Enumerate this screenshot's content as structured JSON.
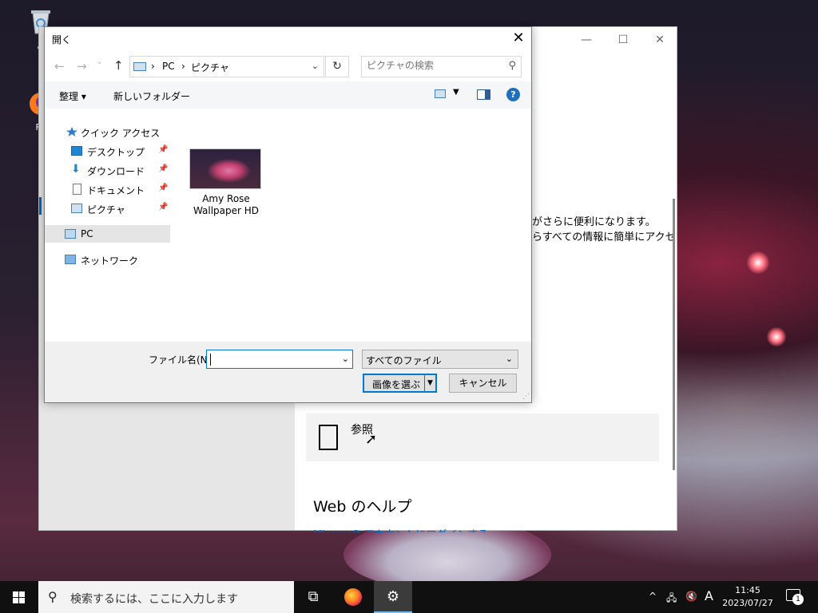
{
  "desktop": {
    "recycle_label": "ご",
    "firefox_label": "Fir"
  },
  "settings_window": {
    "minimize_glyph": "—",
    "maximize_glyph": "☐",
    "close_glyph": "✕",
    "text_line1": "がさらに便利になります。",
    "text_line2": "らすべての情報に簡単にアクセ",
    "browse_label": "参照",
    "web_help_title": "Web のヘルプ",
    "ms_link_partial": "Microsoft アカウントにログインする"
  },
  "dialog": {
    "title": "開く",
    "close_glyph": "✕",
    "nav": {
      "back": "←",
      "forward": "→",
      "recent": "˅",
      "up": "↑",
      "crumbs": [
        "PC",
        "ピクチャ"
      ],
      "separator": "›",
      "search_placeholder": "ピクチャの検索"
    },
    "toolbar": {
      "organize": "整理 ▾",
      "new_folder": "新しいフォルダー",
      "help": "?"
    },
    "navpane": {
      "quick_access": "クイック アクセス",
      "desktop": "デスクトップ",
      "downloads": "ダウンロード",
      "documents": "ドキュメント",
      "pictures": "ピクチャ",
      "pc": "PC",
      "network": "ネットワーク"
    },
    "files": [
      {
        "name_line1": "Amy Rose",
        "name_line2": "Wallpaper HD"
      }
    ],
    "filename_label": "ファイル名(N):",
    "filename_value": "",
    "filter_value": "すべてのファイル",
    "ok_label": "画像を選ぶ",
    "cancel_label": "キャンセル"
  },
  "taskbar": {
    "search_placeholder": "検索するには、ここに入力します",
    "time": "11:45",
    "date": "2023/07/27",
    "ime": "A",
    "notification_count": "1",
    "tray_chevron": "^"
  }
}
